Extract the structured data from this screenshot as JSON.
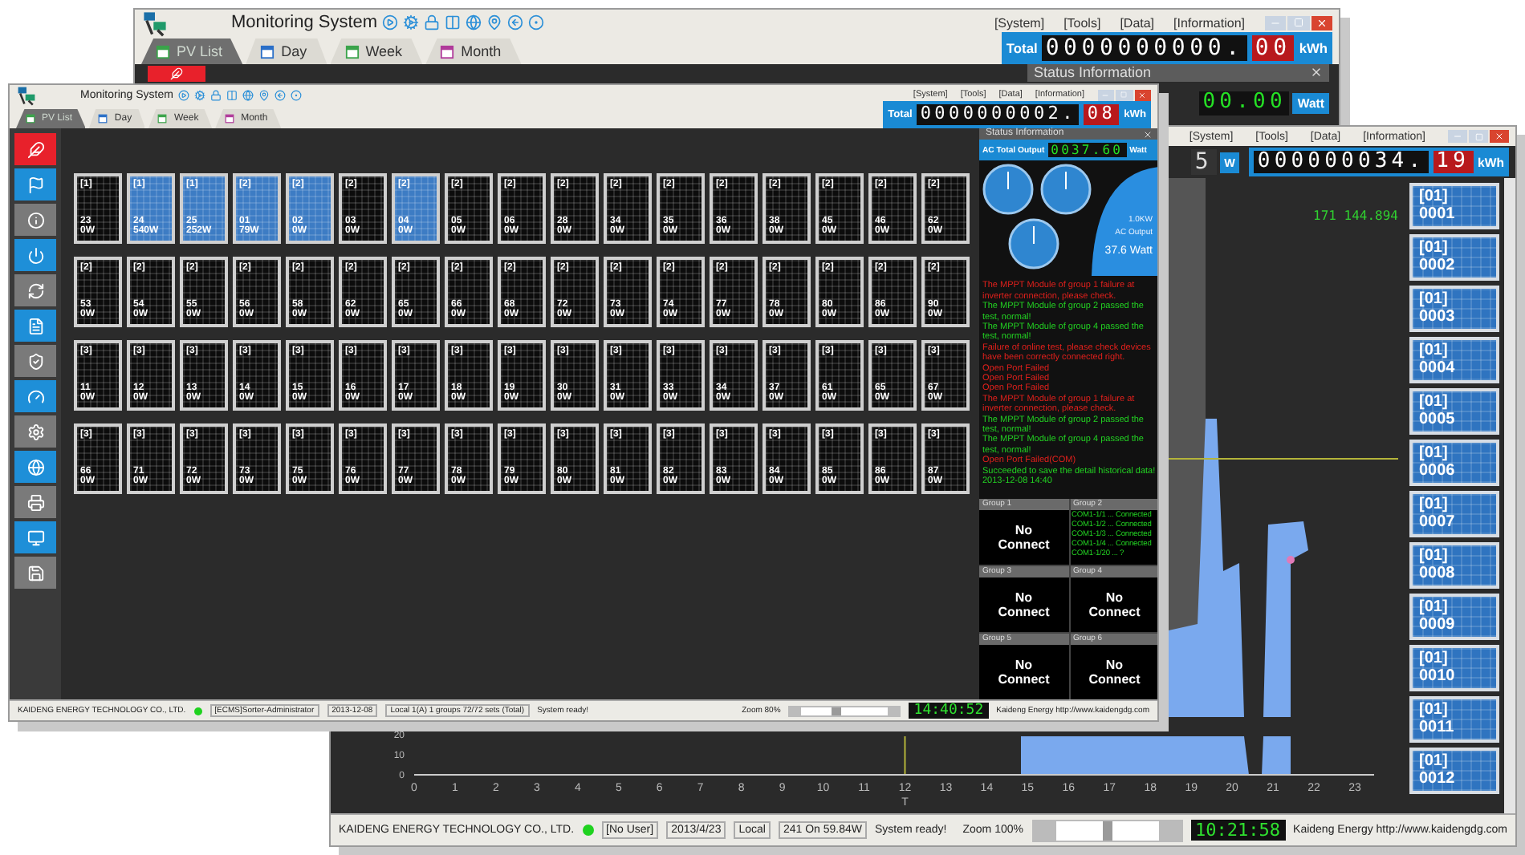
{
  "back_window": {
    "title": "Monitoring System",
    "tabs": [
      {
        "label": "PV List",
        "selected": true
      },
      {
        "label": "Day",
        "selected": false
      },
      {
        "label": "Week",
        "selected": false
      },
      {
        "label": "Month",
        "selected": false
      }
    ],
    "menu": [
      "[System]",
      "[Tools]",
      "[Data]",
      "[Information]"
    ],
    "total": {
      "label": "Total",
      "integer": "0000000000.",
      "decimal": "00",
      "unit": "kWh"
    },
    "status_panel": {
      "title": "Status Information",
      "output_digits": "00.00",
      "output_unit": "Watt"
    }
  },
  "right_window": {
    "menu": [
      "[System]",
      "[Tools]",
      "[Data]",
      "[Information]"
    ],
    "output_fragment": {
      "digit": "5",
      "unit": "W"
    },
    "total": {
      "integer": "000000034.",
      "decimal": "19",
      "unit": "kWh"
    },
    "chart": {
      "reading": "171 144.894",
      "x_ticks": [
        "0",
        "1",
        "2",
        "3",
        "4",
        "5",
        "6",
        "7",
        "8",
        "9",
        "10",
        "11",
        "12",
        "13",
        "14",
        "15",
        "16",
        "17",
        "18",
        "19",
        "20",
        "21",
        "22",
        "23"
      ],
      "y_ticks": [
        "20",
        "10",
        "0"
      ],
      "cursor_label": "T"
    },
    "devices": [
      {
        "group": "[01]",
        "number": "0001"
      },
      {
        "group": "[01]",
        "number": "0002"
      },
      {
        "group": "[01]",
        "number": "0003"
      },
      {
        "group": "[01]",
        "number": "0004"
      },
      {
        "group": "[01]",
        "number": "0005"
      },
      {
        "group": "[01]",
        "number": "0006"
      },
      {
        "group": "[01]",
        "number": "0007"
      },
      {
        "group": "[01]",
        "number": "0008"
      },
      {
        "group": "[01]",
        "number": "0009"
      },
      {
        "group": "[01]",
        "number": "0010"
      },
      {
        "group": "[01]",
        "number": "0011"
      },
      {
        "group": "[01]",
        "number": "0012"
      }
    ],
    "status_bar": {
      "company": "KAIDENG ENERGY TECHNOLOGY CO., LTD.",
      "user": "[No User]",
      "date": "2013/4/23",
      "mode": "Local",
      "summary": "241 On 59.84W",
      "message": "System ready!",
      "zoom": "Zoom 100%",
      "zoom_slider": {
        "level": 0.5
      },
      "clock": "10:21:58",
      "link": "Kaideng Energy http://www.kaidengdg.com"
    }
  },
  "front_window": {
    "title": "Monitoring System",
    "tabs": [
      {
        "label": "PV List",
        "selected": true
      },
      {
        "label": "Day",
        "selected": false
      },
      {
        "label": "Week",
        "selected": false
      },
      {
        "label": "Month",
        "selected": false
      }
    ],
    "menu": [
      "[System]",
      "[Tools]",
      "[Data]",
      "[Information]"
    ],
    "total": {
      "label": "Total",
      "integer": "0000000002.",
      "decimal": "08",
      "unit": "kWh"
    },
    "sidebar": [
      {
        "color": "#e8212b"
      },
      {
        "color": "#1e8fd8"
      },
      {
        "color": "#7a7a7a"
      },
      {
        "color": "#1e8fd8"
      },
      {
        "color": "#7a7a7a"
      },
      {
        "color": "#1e8fd8"
      },
      {
        "color": "#7a7a7a"
      },
      {
        "color": "#1e8fd8"
      },
      {
        "color": "#7a7a7a"
      },
      {
        "color": "#1e8fd8"
      },
      {
        "color": "#7a7a7a"
      },
      {
        "color": "#1e8fd8"
      },
      {
        "color": "#7a7a7a"
      }
    ],
    "rows": [
      {
        "tiles": [
          {
            "group": "[1]",
            "number": "23",
            "power": "0W",
            "selected": false
          },
          {
            "group": "[1]",
            "number": "24",
            "power": "540W",
            "selected": true
          },
          {
            "group": "[1]",
            "number": "25",
            "power": "252W",
            "selected": true
          },
          {
            "group": "[2]",
            "number": "01",
            "power": "79W",
            "selected": true
          },
          {
            "group": "[2]",
            "number": "02",
            "power": "0W",
            "selected": true
          },
          {
            "group": "[2]",
            "number": "03",
            "power": "0W",
            "selected": false
          },
          {
            "group": "[2]",
            "number": "04",
            "power": "0W",
            "selected": true
          },
          {
            "group": "[2]",
            "number": "05",
            "power": "0W",
            "selected": false
          },
          {
            "group": "[2]",
            "number": "06",
            "power": "0W",
            "selected": false
          },
          {
            "group": "[2]",
            "number": "28",
            "power": "0W",
            "selected": false
          },
          {
            "group": "[2]",
            "number": "34",
            "power": "0W",
            "selected": false
          },
          {
            "group": "[2]",
            "number": "35",
            "power": "0W",
            "selected": false
          },
          {
            "group": "[2]",
            "number": "36",
            "power": "0W",
            "selected": false
          },
          {
            "group": "[2]",
            "number": "38",
            "power": "0W",
            "selected": false
          },
          {
            "group": "[2]",
            "number": "45",
            "power": "0W",
            "selected": false
          },
          {
            "group": "[2]",
            "number": "46",
            "power": "0W",
            "selected": false
          },
          {
            "group": "[2]",
            "number": "62",
            "power": "0W",
            "selected": false
          }
        ]
      },
      {
        "tiles": [
          {
            "group": "[2]",
            "number": "53",
            "power": "0W",
            "selected": false
          },
          {
            "group": "[2]",
            "number": "54",
            "power": "0W",
            "selected": false
          },
          {
            "group": "[2]",
            "number": "55",
            "power": "0W",
            "selected": false
          },
          {
            "group": "[2]",
            "number": "56",
            "power": "0W",
            "selected": false
          },
          {
            "group": "[2]",
            "number": "58",
            "power": "0W",
            "selected": false
          },
          {
            "group": "[2]",
            "number": "62",
            "power": "0W",
            "selected": false
          },
          {
            "group": "[2]",
            "number": "65",
            "power": "0W",
            "selected": false
          },
          {
            "group": "[2]",
            "number": "66",
            "power": "0W",
            "selected": false
          },
          {
            "group": "[2]",
            "number": "68",
            "power": "0W",
            "selected": false
          },
          {
            "group": "[2]",
            "number": "72",
            "power": "0W",
            "selected": false
          },
          {
            "group": "[2]",
            "number": "73",
            "power": "0W",
            "selected": false
          },
          {
            "group": "[2]",
            "number": "74",
            "power": "0W",
            "selected": false
          },
          {
            "group": "[2]",
            "number": "77",
            "power": "0W",
            "selected": false
          },
          {
            "group": "[2]",
            "number": "78",
            "power": "0W",
            "selected": false
          },
          {
            "group": "[2]",
            "number": "80",
            "power": "0W",
            "selected": false
          },
          {
            "group": "[2]",
            "number": "86",
            "power": "0W",
            "selected": false
          },
          {
            "group": "[2]",
            "number": "90",
            "power": "0W",
            "selected": false
          }
        ]
      },
      {
        "tiles": [
          {
            "group": "[3]",
            "number": "11",
            "power": "0W",
            "selected": false
          },
          {
            "group": "[3]",
            "number": "12",
            "power": "0W",
            "selected": false
          },
          {
            "group": "[3]",
            "number": "13",
            "power": "0W",
            "selected": false
          },
          {
            "group": "[3]",
            "number": "14",
            "power": "0W",
            "selected": false
          },
          {
            "group": "[3]",
            "number": "15",
            "power": "0W",
            "selected": false
          },
          {
            "group": "[3]",
            "number": "16",
            "power": "0W",
            "selected": false
          },
          {
            "group": "[3]",
            "number": "17",
            "power": "0W",
            "selected": false
          },
          {
            "group": "[3]",
            "number": "18",
            "power": "0W",
            "selected": false
          },
          {
            "group": "[3]",
            "number": "19",
            "power": "0W",
            "selected": false
          },
          {
            "group": "[3]",
            "number": "30",
            "power": "0W",
            "selected": false
          },
          {
            "group": "[3]",
            "number": "31",
            "power": "0W",
            "selected": false
          },
          {
            "group": "[3]",
            "number": "33",
            "power": "0W",
            "selected": false
          },
          {
            "group": "[3]",
            "number": "34",
            "power": "0W",
            "selected": false
          },
          {
            "group": "[3]",
            "number": "37",
            "power": "0W",
            "selected": false
          },
          {
            "group": "[3]",
            "number": "61",
            "power": "0W",
            "selected": false
          },
          {
            "group": "[3]",
            "number": "65",
            "power": "0W",
            "selected": false
          },
          {
            "group": "[3]",
            "number": "67",
            "power": "0W",
            "selected": false
          }
        ]
      },
      {
        "tiles": [
          {
            "group": "[3]",
            "number": "66",
            "power": "0W",
            "selected": false
          },
          {
            "group": "[3]",
            "number": "71",
            "power": "0W",
            "selected": false
          },
          {
            "group": "[3]",
            "number": "72",
            "power": "0W",
            "selected": false
          },
          {
            "group": "[3]",
            "number": "73",
            "power": "0W",
            "selected": false
          },
          {
            "group": "[3]",
            "number": "75",
            "power": "0W",
            "selected": false
          },
          {
            "group": "[3]",
            "number": "76",
            "power": "0W",
            "selected": false
          },
          {
            "group": "[3]",
            "number": "77",
            "power": "0W",
            "selected": false
          },
          {
            "group": "[3]",
            "number": "78",
            "power": "0W",
            "selected": false
          },
          {
            "group": "[3]",
            "number": "79",
            "power": "0W",
            "selected": false
          },
          {
            "group": "[3]",
            "number": "80",
            "power": "0W",
            "selected": false
          },
          {
            "group": "[3]",
            "number": "81",
            "power": "0W",
            "selected": false
          },
          {
            "group": "[3]",
            "number": "82",
            "power": "0W",
            "selected": false
          },
          {
            "group": "[3]",
            "number": "83",
            "power": "0W",
            "selected": false
          },
          {
            "group": "[3]",
            "number": "84",
            "power": "0W",
            "selected": false
          },
          {
            "group": "[3]",
            "number": "85",
            "power": "0W",
            "selected": false
          },
          {
            "group": "[3]",
            "number": "86",
            "power": "0W",
            "selected": false
          },
          {
            "group": "[3]",
            "number": "87",
            "power": "0W",
            "selected": false
          }
        ]
      }
    ],
    "status_panel": {
      "title": "Status Information",
      "output_label": "AC Total Output",
      "output_digits": "0037.60",
      "output_unit": "Watt",
      "gauge": {
        "rating": "1.0KW",
        "label": "AC Output",
        "reading": "37.6 Watt"
      },
      "log": [
        {
          "text": "The MPPT Module of group 1 failure at inverter connection, please check.",
          "color": "#e0201c"
        },
        {
          "text": "The MPPT Module of group 2 passed the test, normal!",
          "color": "#22d022"
        },
        {
          "text": "The MPPT Module of group 4 passed the test, normal!",
          "color": "#22d022"
        },
        {
          "text": "Failure of online test, please check devices have been correctly connected right.",
          "color": "#e0201c"
        },
        {
          "text": "Open Port Failed",
          "color": "#e0201c"
        },
        {
          "text": "Open Port Failed",
          "color": "#e0201c"
        },
        {
          "text": "Open Port Failed",
          "color": "#e0201c"
        },
        {
          "text": "The MPPT Module of group 1 failure at inverter connection, please check.",
          "color": "#e0201c"
        },
        {
          "text": "The MPPT Module of group 2 passed the test, normal!",
          "color": "#22d022"
        },
        {
          "text": "The MPPT Module of group 4 passed the test, normal!",
          "color": "#22d022"
        },
        {
          "text": "Open Port Failed(COM)",
          "color": "#e0201c"
        },
        {
          "text": "Succeeded to save the detail historical data!",
          "color": "#22d022"
        },
        {
          "text": "2013-12-08 14:40",
          "color": "#22d022"
        }
      ],
      "groups": [
        {
          "title": "Group 1",
          "kind": "status",
          "text": "No Connect"
        },
        {
          "title": "Group 2",
          "kind": "lines",
          "lines": [
            "COM1-1/1 ... Connected",
            "COM1-1/2 ... Connected",
            "COM1-1/3 ... Connected",
            "COM1-1/4 ... Connected",
            "COM1-1/20 ... ?"
          ]
        },
        {
          "title": "Group 3",
          "kind": "status",
          "text": "No Connect"
        },
        {
          "title": "Group 4",
          "kind": "status",
          "text": "No Connect"
        },
        {
          "title": "Group 5",
          "kind": "status",
          "text": "No Connect"
        },
        {
          "title": "Group 6",
          "kind": "status",
          "text": "No Connect"
        }
      ]
    },
    "status_bar": {
      "company": "KAIDENG ENERGY TECHNOLOGY CO., LTD.",
      "user": "[ECMS]Sorter-Administrator",
      "date": "2013-12-08",
      "summary": "Local 1(A) 1 groups 72/72 sets (Total)",
      "message": "System ready!",
      "zoom": "Zoom 80%",
      "zoom_slider": {
        "level": 0.4
      },
      "clock": "14:40:52",
      "link": "Kaideng Energy http://www.kaidengdg.com"
    }
  }
}
